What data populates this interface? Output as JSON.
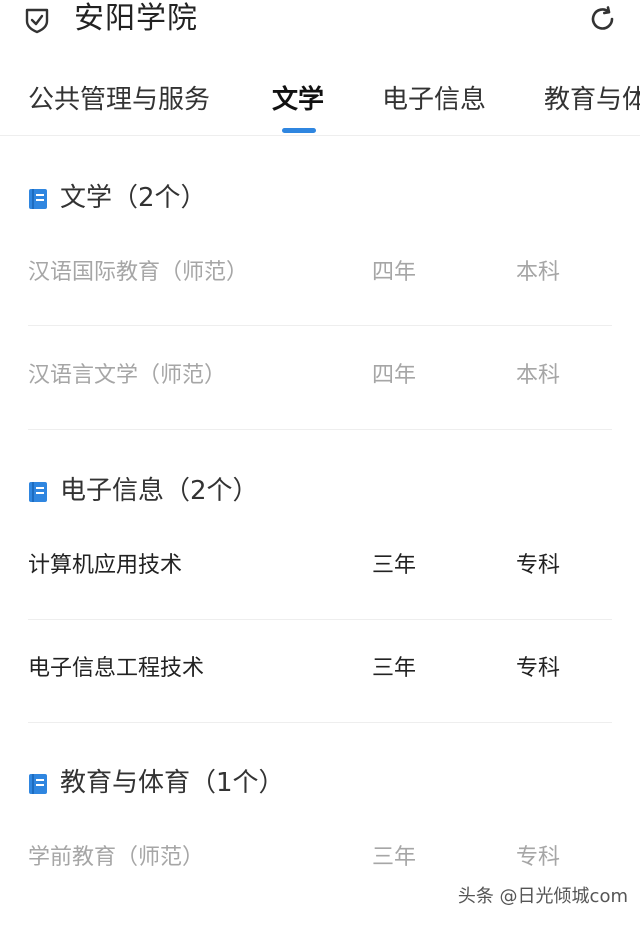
{
  "header": {
    "title": "安阳学院",
    "left_icon": "shield-check-icon",
    "right_icon": "refresh-icon"
  },
  "tabs": [
    {
      "label": "公共管理与服务",
      "active": false
    },
    {
      "label": "文学",
      "active": true
    },
    {
      "label": "电子信息",
      "active": false
    },
    {
      "label": "教育与体",
      "active": false
    }
  ],
  "accent_color": "#2f86e0",
  "sections": [
    {
      "title": "文学（2个）",
      "rows": [
        {
          "name": "汉语国际教育（师范）",
          "duration": "四年",
          "level": "本科",
          "muted": true
        },
        {
          "name": "汉语言文学（师范）",
          "duration": "四年",
          "level": "本科",
          "muted": true
        }
      ]
    },
    {
      "title": "电子信息（2个）",
      "rows": [
        {
          "name": "计算机应用技术",
          "duration": "三年",
          "level": "专科",
          "muted": false
        },
        {
          "name": "电子信息工程技术",
          "duration": "三年",
          "level": "专科",
          "muted": false
        }
      ]
    },
    {
      "title": "教育与体育（1个）",
      "rows": [
        {
          "name": "学前教育（师范）",
          "duration": "三年",
          "level": "专科",
          "muted": true
        }
      ]
    }
  ],
  "watermark": "头条 @日光倾城com"
}
